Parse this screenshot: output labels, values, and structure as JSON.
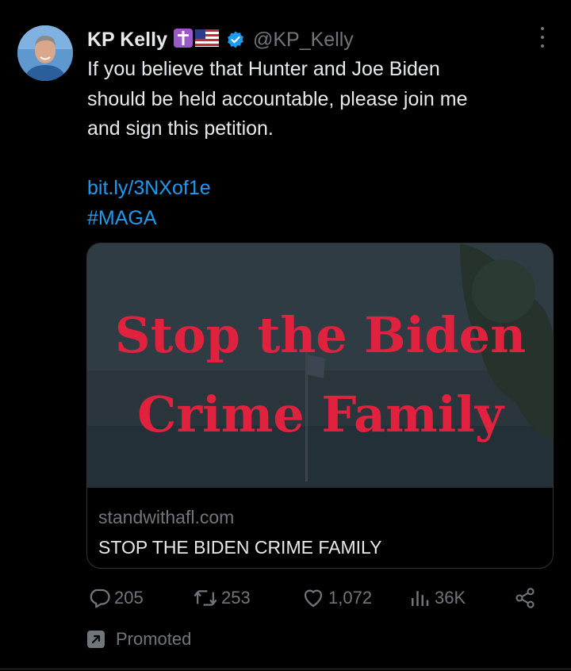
{
  "tweet": {
    "display_name": "KP Kelly",
    "name_emojis": [
      "latin-cross-emoji",
      "us-flag-emoji"
    ],
    "handle": "@KP_Kelly",
    "text_lines": [
      "If you believe that Hunter and Joe Biden",
      "should be held accountable, please join me",
      "and sign this petition."
    ],
    "link": "bit.ly/3NXof1e",
    "hashtag": "#MAGA"
  },
  "card": {
    "image_headline_line1": "Stop the Biden",
    "image_headline_line2": "Crime Family",
    "domain": "standwithafl.com",
    "title": "STOP THE BIDEN CRIME FAMILY"
  },
  "actions": {
    "replies": "205",
    "reposts": "253",
    "likes": "1,072",
    "views": "36K"
  },
  "promoted_label": "Promoted",
  "colors": {
    "background": "#000000",
    "text": "#e7e9ea",
    "muted": "#71767b",
    "link": "#1d9bf0",
    "headline_red": "#e0223f",
    "verified": "#1d9bf0"
  }
}
